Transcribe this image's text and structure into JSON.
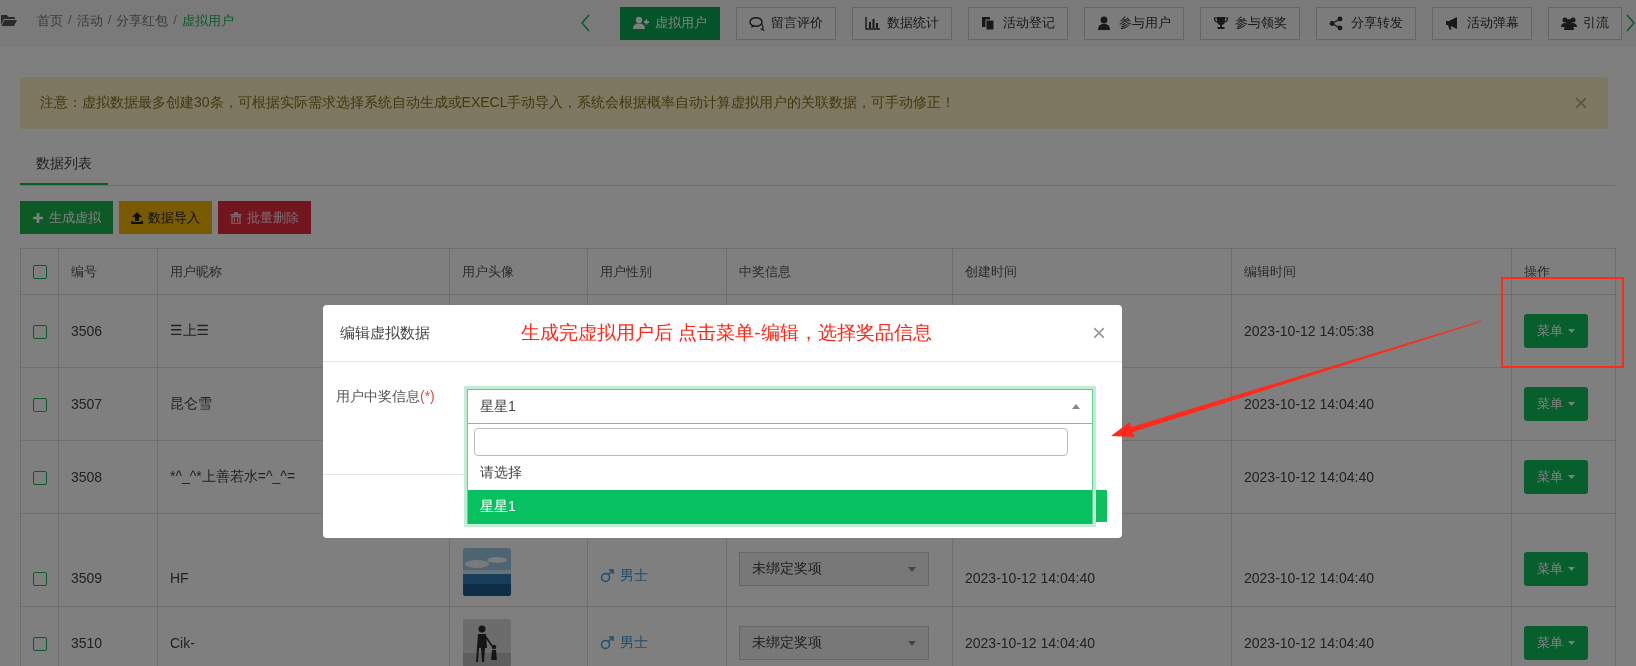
{
  "breadcrumb_separator": "/",
  "breadcrumb": [
    {
      "label": "首页",
      "current": false
    },
    {
      "label": "活动",
      "current": false
    },
    {
      "label": "分享红包",
      "current": false
    },
    {
      "label": "虚拟用户",
      "current": true
    }
  ],
  "nav_buttons": [
    {
      "label": "虚拟用户",
      "selected": true
    },
    {
      "label": "留言评价",
      "selected": false
    },
    {
      "label": "数据统计",
      "selected": false
    },
    {
      "label": "活动登记",
      "selected": false
    },
    {
      "label": "参与用户",
      "selected": false
    },
    {
      "label": "参与领奖",
      "selected": false
    },
    {
      "label": "分享转发",
      "selected": false
    },
    {
      "label": "活动弹幕",
      "selected": false
    },
    {
      "label": "引流",
      "selected": false
    }
  ],
  "alert": {
    "text": "注意：虚拟数据最多创建30条，可根据实际需求选择系统自动生成或EXECL手动导入，系统会根据概率自动计算虚拟用户的关联数据，可手动修正！",
    "close": "×"
  },
  "tabs": [
    {
      "label": "数据列表",
      "selected": true
    }
  ],
  "actions": [
    {
      "label": "生成虚拟",
      "kind": "success"
    },
    {
      "label": "数据导入",
      "kind": "warning"
    },
    {
      "label": "批量删除",
      "kind": "danger"
    }
  ],
  "table": {
    "select_all": {
      "checked": false
    },
    "columns": [
      "编号",
      "用户昵称",
      "用户头像",
      "用户性别",
      "中奖信息",
      "创建时间",
      "编辑时间",
      "操作"
    ],
    "rows": [
      {
        "checked": false,
        "id": "3506",
        "nickname": "☰上☰",
        "edited": "2023-10-12 14:05:38",
        "menu": "菜单"
      },
      {
        "checked": false,
        "id": "3507",
        "nickname": "昆仑雪",
        "edited": "2023-10-12 14:04:40",
        "menu": "菜单"
      },
      {
        "checked": false,
        "id": "3508",
        "nickname": "*^_^*上善若水=^_^=",
        "edited": "2023-10-12 14:04:40",
        "menu": "菜单"
      },
      {
        "checked": false,
        "id": "3509",
        "nickname": "HF",
        "gender": "男士",
        "prize": "未绑定奖项",
        "created": "2023-10-12 14:04:40",
        "edited": "2023-10-12 14:04:40",
        "menu": "菜单"
      },
      {
        "checked": false,
        "id": "3510",
        "nickname": "Cik-",
        "gender": "男士",
        "prize": "未绑定奖项",
        "created": "2023-10-12 14:04:40",
        "edited": "2023-10-12 14:04:40",
        "menu": "菜单"
      }
    ]
  },
  "modal": {
    "title": "编辑虚拟数据",
    "note": "生成完虚拟用户后 点击菜单-编辑，选择奖品信息",
    "close": "×",
    "field": {
      "label": "用户中奖信息",
      "required_mark": "(*)",
      "value": "星星1",
      "expanded": true,
      "options": [
        {
          "label": "请选择",
          "selected": false
        },
        {
          "label": "星星1",
          "selected": true
        }
      ]
    }
  }
}
